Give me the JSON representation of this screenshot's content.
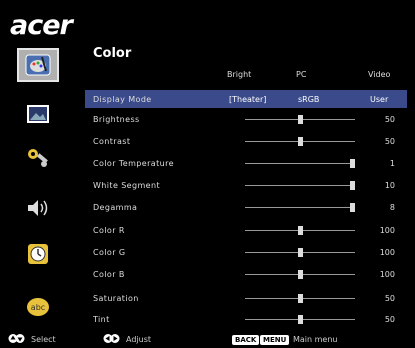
{
  "brand": "acer",
  "panel": {
    "title": "Color"
  },
  "columns": [
    "Bright",
    "PC",
    "Video"
  ],
  "display_mode": {
    "label": "Display Mode",
    "options": [
      "[Theater]",
      "sRGB",
      "User"
    ]
  },
  "rows": [
    {
      "label": "Brightness",
      "value": "50",
      "level": 0.5
    },
    {
      "label": "Contrast",
      "value": "50",
      "level": 0.5
    },
    {
      "label": "Color Temperature",
      "value": "1",
      "level": 1.0
    },
    {
      "label": "White Segment",
      "value": "10",
      "level": 1.0
    },
    {
      "label": "Degamma",
      "value": "8",
      "level": 1.0
    },
    {
      "label": "Color R",
      "value": "100",
      "level": 0.5
    },
    {
      "label": "Color G",
      "value": "100",
      "level": 0.5
    },
    {
      "label": "Color B",
      "value": "100",
      "level": 0.5
    },
    {
      "label": "Saturation",
      "value": "50",
      "level": 0.5
    },
    {
      "label": "Tint",
      "value": "50",
      "level": 0.5
    }
  ],
  "sidebar": [
    "color-icon",
    "image-icon",
    "settings-icon",
    "audio-icon",
    "timer-icon",
    "language-icon"
  ],
  "footer": {
    "select": "Select",
    "adjust": "Adjust",
    "back": "BACK",
    "menu": "MENU",
    "main_menu": "Main menu"
  },
  "colors": {
    "selected_row": "#3a4a8a",
    "active_icon_bg": "#b0b0b0"
  }
}
